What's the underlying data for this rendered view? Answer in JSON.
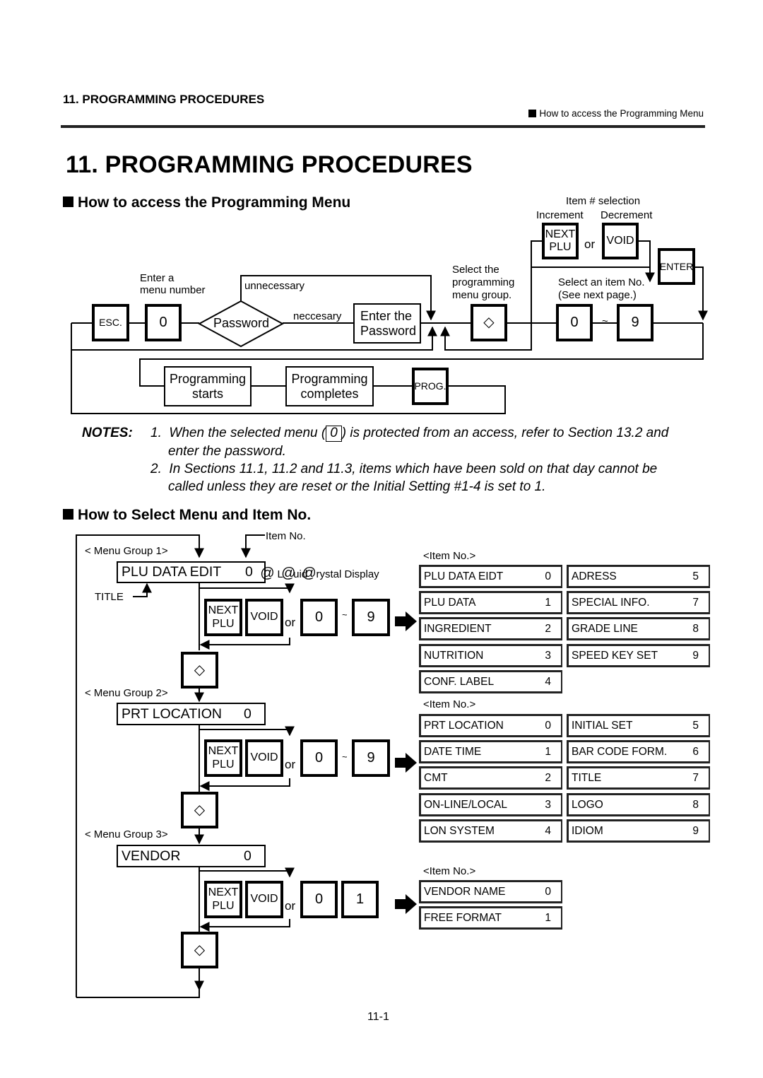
{
  "header": {
    "running_title": "11. PROGRAMMING PROCEDURES",
    "running_section": "How to access the Programming Menu"
  },
  "page_title": "11.  PROGRAMMING PROCEDURES",
  "section1": {
    "heading": "How to access the Programming Menu",
    "flow": {
      "esc_key": "ESC.",
      "menu_number_label": "Enter a\nmenu number",
      "menu_number_line1": "Enter a",
      "menu_number_line2": "menu number",
      "zero_key": "0",
      "password_decision": "Password",
      "unnecessary_label": "unnecessary",
      "necessary_label": "neccesary",
      "enter_password_line1": "Enter the",
      "enter_password_line2": "Password",
      "select_group_line1": "Select the",
      "select_group_line2": "programming",
      "select_group_line3": "menu group.",
      "diamond_key": "◇",
      "item_selection_label": "Item # selection",
      "increment_label": "Increment",
      "decrement_label": "Decrement",
      "next_plu_line1": "NEXT",
      "next_plu_line2": "PLU",
      "or_label": "or",
      "void_key": "VOID",
      "enter_key": "ENTER",
      "select_item_line1": "Select an item No.",
      "select_item_line2": "(See next page.)",
      "key_0": "0",
      "tilde": "~",
      "key_9": "9",
      "prog_starts_line1": "Programming",
      "prog_starts_line2": "starts",
      "prog_completes_line1": "Programming",
      "prog_completes_line2": "completes",
      "prog_key": "PROG."
    }
  },
  "notes": {
    "label": "NOTES:",
    "items": [
      {
        "num": "1.",
        "pre": "When the selected menu (",
        "key": "0",
        "post": ") is protected from an access, refer to Section 13.2 and",
        "cont": "enter the password."
      },
      {
        "num": "2.",
        "line1": "In Sections 11.1, 11.2 and 11.3, items which have been sold on that day cannot be",
        "line2": "called unless they are reset or the Initial Setting #1-4 is set to 1."
      }
    ]
  },
  "section2": {
    "heading": "How to Select Menu and Item No.",
    "item_no_callout": "Item No.",
    "title_callout": "TITLE",
    "lcd_callout": "@ Liquid@Crystal Display",
    "lcd_callout_at1": "@",
    "lcd_callout_text": "Liquid",
    "lcd_callout_at2": "@@",
    "lcd_callout_text2": "rystal Display",
    "next_line1": "NEXT",
    "next_line2": "PLU",
    "void": "VOID",
    "or": "or",
    "tilde": "~",
    "diamond": "◇",
    "item_no_header": "<Item No.>",
    "groups": [
      {
        "label": "< Menu Group 1>",
        "lcd_title": "PLU DATA EDIT",
        "lcd_value": "0",
        "key_a": "0",
        "key_b": "9",
        "items_left": [
          {
            "name": "PLU DATA EIDT",
            "no": "0"
          },
          {
            "name": "PLU DATA",
            "no": "1"
          },
          {
            "name": "INGREDIENT",
            "no": "2"
          },
          {
            "name": "NUTRITION",
            "no": "3"
          },
          {
            "name": "CONF. LABEL",
            "no": "4"
          }
        ],
        "items_right": [
          {
            "name": "ADRESS",
            "no": "5"
          },
          {
            "name": "SPECIAL INFO.",
            "no": "7"
          },
          {
            "name": "GRADE LINE",
            "no": "8"
          },
          {
            "name": "SPEED KEY SET",
            "no": "9"
          }
        ]
      },
      {
        "label": "< Menu Group 2>",
        "lcd_title": "PRT LOCATION",
        "lcd_value": "0",
        "key_a": "0",
        "key_b": "9",
        "items_left": [
          {
            "name": "PRT LOCATION",
            "no": "0"
          },
          {
            "name": "DATE TIME",
            "no": "1"
          },
          {
            "name": "CMT",
            "no": "2"
          },
          {
            "name": "ON-LINE/LOCAL",
            "no": "3"
          },
          {
            "name": "LON SYSTEM",
            "no": "4"
          }
        ],
        "items_right": [
          {
            "name": "INITIAL SET",
            "no": "5"
          },
          {
            "name": "BAR CODE FORM.",
            "no": "6"
          },
          {
            "name": "TITLE",
            "no": "7"
          },
          {
            "name": "LOGO",
            "no": "8"
          },
          {
            "name": "IDIOM",
            "no": "9"
          }
        ]
      },
      {
        "label": "< Menu Group 3>",
        "lcd_title": "VENDOR",
        "lcd_value": "0",
        "key_a": "0",
        "key_b": "1",
        "items_left": [
          {
            "name": "VENDOR NAME",
            "no": "0"
          },
          {
            "name": "FREE FORMAT",
            "no": "1"
          }
        ],
        "items_right": []
      }
    ]
  },
  "page_number": "11-1"
}
